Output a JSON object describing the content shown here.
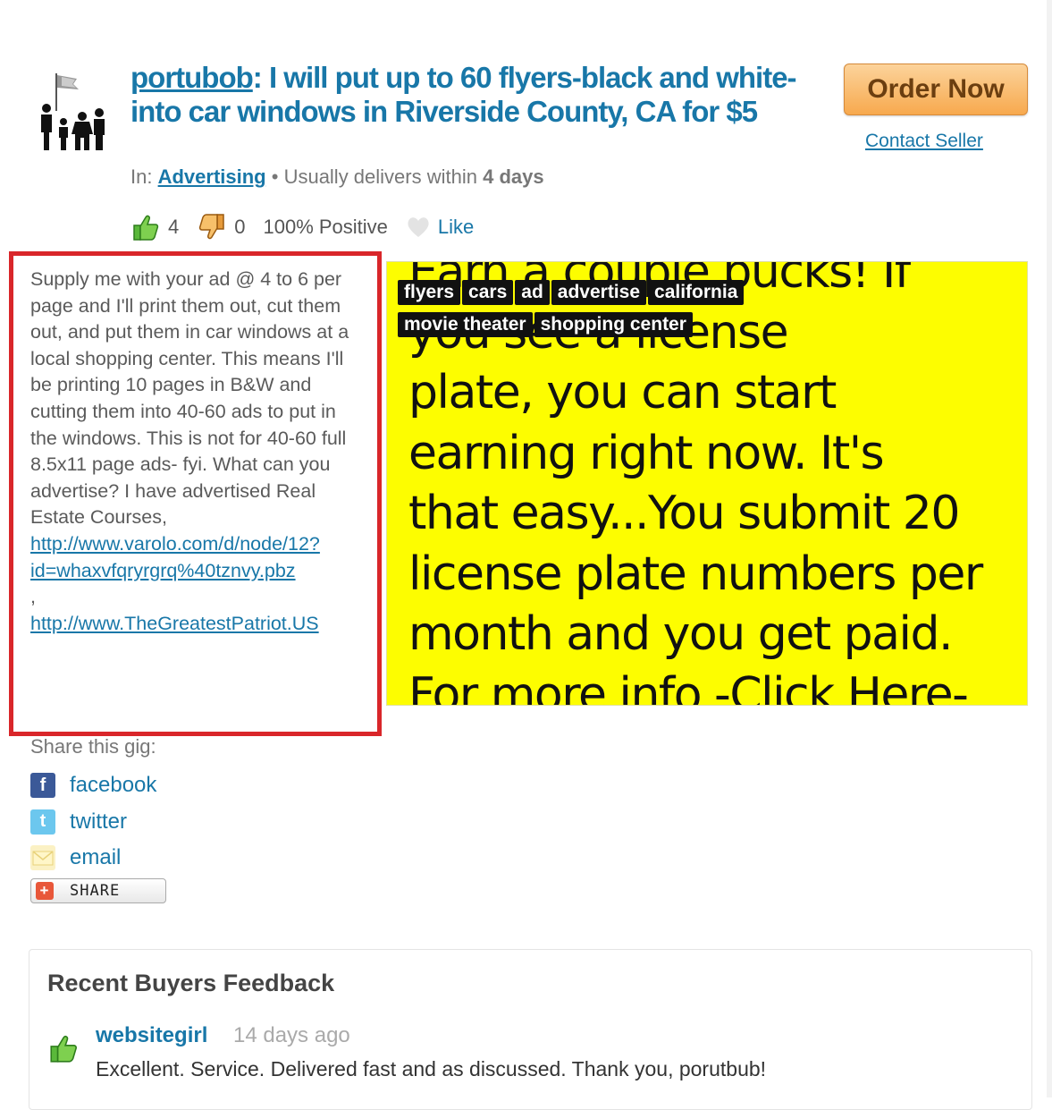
{
  "gig": {
    "seller": "portubob",
    "title": ": I will put up to 60 flyers-black and white-into car windows in Riverside County, CA for $5",
    "in_label": "In:",
    "category": "Advertising",
    "delivery_prefix": "• Usually delivers within",
    "delivery_days": "4 days"
  },
  "actions": {
    "order_label": "Order Now",
    "contact_label": "Contact Seller"
  },
  "stats": {
    "thumbs_up": "4",
    "thumbs_down": "0",
    "positive": "100% Positive",
    "like_label": "Like"
  },
  "description": {
    "text": "Supply me with your ad @ 4 to 6 per page and I'll print them out, cut them out, and put them in car windows at a local shopping center. This means I'll be printing 10 pages in B&W and cutting them into 40-60 ads to put in the windows. This is not for 40-60 full 8.5x11 page ads- fyi. What can you advertise? I have advertised Real Estate Courses,",
    "link1": "http://www.varolo.com/d/node/12?id=whaxvfqryrgrq%40tznvy.pbz",
    "separator": ",",
    "link2": "http://www.TheGreatestPatriot.US"
  },
  "preview": {
    "line0": "Earn a couple bucks! If",
    "line1": "you see a license",
    "line2": "plate, you can start",
    "line3": "earning right now.  It's",
    "line4": "that easy...You submit 20",
    "line5": "license plate numbers per",
    "line6": "month and you get paid.",
    "line7": "For more info -Click Here-",
    "background_color": "#fdfd00"
  },
  "tags": [
    "flyers",
    "cars",
    "ad",
    "advertise",
    "california",
    "movie theater",
    "shopping center"
  ],
  "share": {
    "label": "Share this gig:",
    "items": [
      {
        "label": "facebook",
        "icon": "facebook-icon"
      },
      {
        "label": "twitter",
        "icon": "twitter-icon"
      },
      {
        "label": "email",
        "icon": "email-icon"
      }
    ],
    "share_button": "SHARE"
  },
  "feedback": {
    "title": "Recent Buyers Feedback",
    "items": [
      {
        "user": "websitegirl",
        "time": "14 days ago",
        "text": "Excellent. Service. Delivered fast and as discussed. Thank you, porutbub!"
      }
    ]
  },
  "colors": {
    "link": "#1877a8",
    "highlight_border": "#d9262a",
    "order_button": "#f7a94e"
  }
}
